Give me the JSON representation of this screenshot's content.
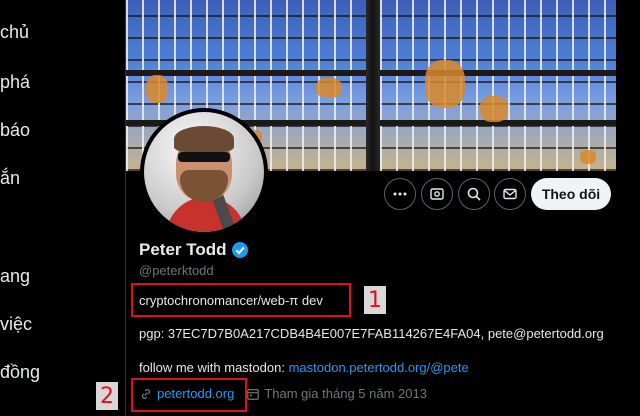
{
  "nav": {
    "items": [
      "chủ",
      "phá",
      "báo",
      "ắn",
      "ang",
      "việc",
      "đồng"
    ]
  },
  "actions": {
    "more_icon": "more-icon",
    "grok_icon": "grok-icon",
    "search_icon": "search-icon",
    "message_icon": "message-icon",
    "follow_label": "Theo dõi"
  },
  "profile": {
    "name": "Peter Todd",
    "handle": "@peterktodd",
    "bio": "cryptochronomancer/web-π dev",
    "pgp": "pgp: 37EC7D7B0A217CDB4B4E007E7FAB114267E4FA04, pete@petertodd.org",
    "follow_prefix": "follow me with mastodon: ",
    "mastodon_link": "mastodon.petertodd.org/@pete",
    "website": "petertodd.org",
    "joined": "Tham gia tháng 5 năm 2013"
  },
  "annotations": {
    "marker_1": "1",
    "marker_2": "2"
  },
  "colors": {
    "background": "#000000",
    "text": "#e7e9ea",
    "secondary": "#71767b",
    "link": "#1d9bf0",
    "verified": "#1d9bf0",
    "annotation": "#e0101a"
  }
}
